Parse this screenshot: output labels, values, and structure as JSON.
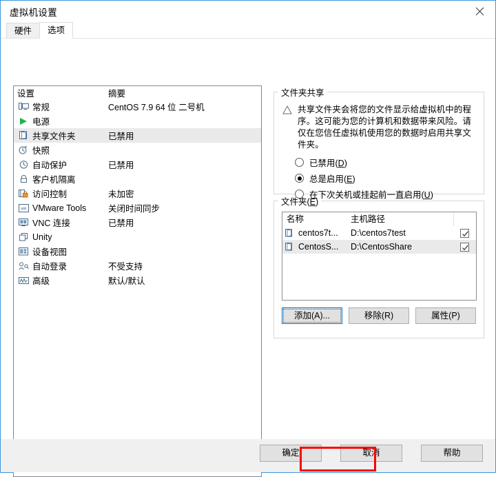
{
  "window": {
    "title": "虚拟机设置",
    "close_icon": "close-icon"
  },
  "tabs": [
    {
      "label": "硬件",
      "active": false
    },
    {
      "label": "选项",
      "active": true
    }
  ],
  "settings_list": {
    "header": {
      "name": "设置",
      "summary": "摘要"
    },
    "rows": [
      {
        "icon": "monitor-icon",
        "name": "常规",
        "summary": "CentOS 7.9 64 位 二号机",
        "selected": false
      },
      {
        "icon": "play-icon",
        "name": "电源",
        "summary": "",
        "selected": false
      },
      {
        "icon": "folder-icon",
        "name": "共享文件夹",
        "summary": "已禁用",
        "selected": true
      },
      {
        "icon": "snapshot-icon",
        "name": "快照",
        "summary": "",
        "selected": false
      },
      {
        "icon": "clock-icon",
        "name": "自动保护",
        "summary": "已禁用",
        "selected": false
      },
      {
        "icon": "lock-icon",
        "name": "客户机隔离",
        "summary": "",
        "selected": false
      },
      {
        "icon": "access-lock-icon",
        "name": "访问控制",
        "summary": "未加密",
        "selected": false
      },
      {
        "icon": "vmware-tools-icon",
        "name": "VMware Tools",
        "summary": "关闭时间同步",
        "selected": false
      },
      {
        "icon": "vnc-icon",
        "name": "VNC 连接",
        "summary": "已禁用",
        "selected": false
      },
      {
        "icon": "unity-icon",
        "name": "Unity",
        "summary": "",
        "selected": false
      },
      {
        "icon": "device-view-icon",
        "name": "设备视图",
        "summary": "",
        "selected": false
      },
      {
        "icon": "auto-login-icon",
        "name": "自动登录",
        "summary": "不受支持",
        "selected": false
      },
      {
        "icon": "advanced-icon",
        "name": "高级",
        "summary": "默认/默认",
        "selected": false
      }
    ]
  },
  "folder_sharing": {
    "legend": "文件夹共享",
    "warning_icon": "warning-triangle-icon",
    "warning_text": "共享文件夹会将您的文件显示给虚拟机中的程序。这可能为您的计算机和数据带来风险。请仅在您信任虚拟机使用您的数据时启用共享文件夹。",
    "options": [
      {
        "label_pre": "已禁用(",
        "accel": "D",
        "label_post": ")",
        "selected": false
      },
      {
        "label_pre": "总是启用(",
        "accel": "E",
        "label_post": ")",
        "selected": true
      },
      {
        "label_pre": "在下次关机或挂起前一直启用(",
        "accel": "U",
        "label_post": ")",
        "selected": false
      }
    ]
  },
  "folders": {
    "legend_pre": "文件夹(",
    "legend_accel": "E",
    "legend_post": ")",
    "columns": {
      "name": "名称",
      "path": "主机路径"
    },
    "rows": [
      {
        "icon": "folder-icon",
        "name": "centos7t...",
        "path": "D:\\centos7test",
        "checked": true,
        "selected": false
      },
      {
        "icon": "folder-icon",
        "name": "CentosS...",
        "path": "D:\\CentosShare",
        "checked": true,
        "selected": true
      }
    ],
    "buttons": [
      {
        "label": "添加(A)...",
        "focused": true
      },
      {
        "label": "移除(R)",
        "focused": false
      },
      {
        "label": "属性(P)",
        "focused": false
      }
    ]
  },
  "footer": {
    "buttons": [
      {
        "label": "确定",
        "highlighted": true
      },
      {
        "label": "取消",
        "highlighted": false
      },
      {
        "label": "帮助",
        "highlighted": false
      }
    ]
  },
  "annotation": {
    "color": "#fb0000"
  }
}
